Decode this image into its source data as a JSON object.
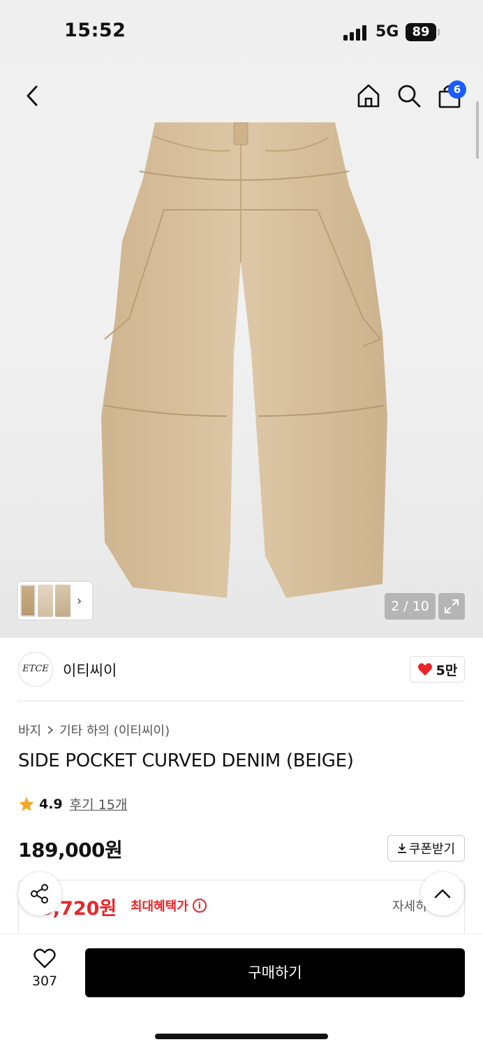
{
  "status": {
    "time": "15:52",
    "network": "5G",
    "battery": "89"
  },
  "nav": {
    "cart_count": "6"
  },
  "gallery": {
    "counter": "2 / 10",
    "thumb_chevron": "›"
  },
  "brand": {
    "logo_text": "ETCE",
    "name": "이티씨이",
    "like_count": "5만"
  },
  "breadcrumb": [
    "바지",
    "기타 하의 (이티씨이)"
  ],
  "product": {
    "title": "SIDE POCKET CURVED DENIM (BEIGE)",
    "rating": "4.9",
    "reviews": "후기 15개",
    "price": "189,000원",
    "coupon_label": "쿠폰받기"
  },
  "benefit": {
    "price": "5,720원",
    "label": "최대혜택가",
    "detail": "자세히"
  },
  "bottom": {
    "wish_count": "307",
    "buy_label": "구매하기"
  },
  "colors": {
    "accent_red": "#e8262b",
    "badge_blue": "#1a5cff",
    "pants_beige": "#d9c2a1"
  },
  "icons": [
    "back-icon",
    "home-icon",
    "search-icon",
    "cart-icon",
    "expand-icon",
    "heart-icon",
    "star-icon",
    "download-icon",
    "info-icon",
    "share-icon",
    "chevron-up-icon"
  ]
}
